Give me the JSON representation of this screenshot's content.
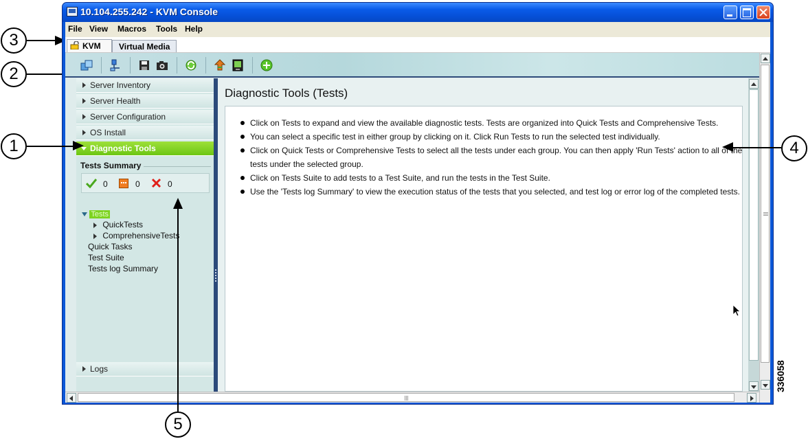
{
  "window": {
    "title": "10.104.255.242 - KVM Console"
  },
  "menu": [
    "File",
    "View",
    "Macros",
    "Tools",
    "Help"
  ],
  "tabs": [
    {
      "label": "KVM",
      "active": true
    },
    {
      "label": "Virtual Media",
      "active": false
    }
  ],
  "toolbar": {
    "icons": [
      "macro-keys-icon",
      "network-connection-icon",
      "save-icon",
      "camera-icon",
      "refresh-icon",
      "upload-icon",
      "monitor-icon",
      "help-icon"
    ]
  },
  "sidebar": {
    "sections": [
      "Server Inventory",
      "Server Health",
      "Server Configuration",
      "OS Install",
      "Diagnostic Tools"
    ],
    "selected": "Diagnostic Tools",
    "bottom_section": "Logs"
  },
  "tests_summary": {
    "title": "Tests Summary",
    "passed": "0",
    "in_progress": "0",
    "failed": "0"
  },
  "tree": {
    "root": "Tests",
    "children": [
      "QuickTests",
      "ComprehensiveTests"
    ],
    "items": [
      "Quick Tasks",
      "Test Suite",
      "Tests log Summary"
    ]
  },
  "main": {
    "title": "Diagnostic Tools (Tests)",
    "bullets": [
      "Click on Tests to expand and view the available diagnostic tests. Tests are organized into Quick Tests and Comprehensive Tests.",
      "You can select a specific test in either group by clicking on it. Click Run Tests to run the selected test individually.",
      "Click on Quick Tests or Comprehensive Tests to select all the tests under each group. You can then apply 'Run Tests' action to all of the tests under the selected group.",
      "Click on Tests Suite to add tests to a Test Suite, and run the tests in the Test Suite.",
      "Use the 'Tests log Summary' to view the execution status of the tests that you selected, and test log or error log of the completed tests."
    ]
  },
  "callouts": [
    "1",
    "2",
    "3",
    "4",
    "5"
  ],
  "figure_id": "336058"
}
